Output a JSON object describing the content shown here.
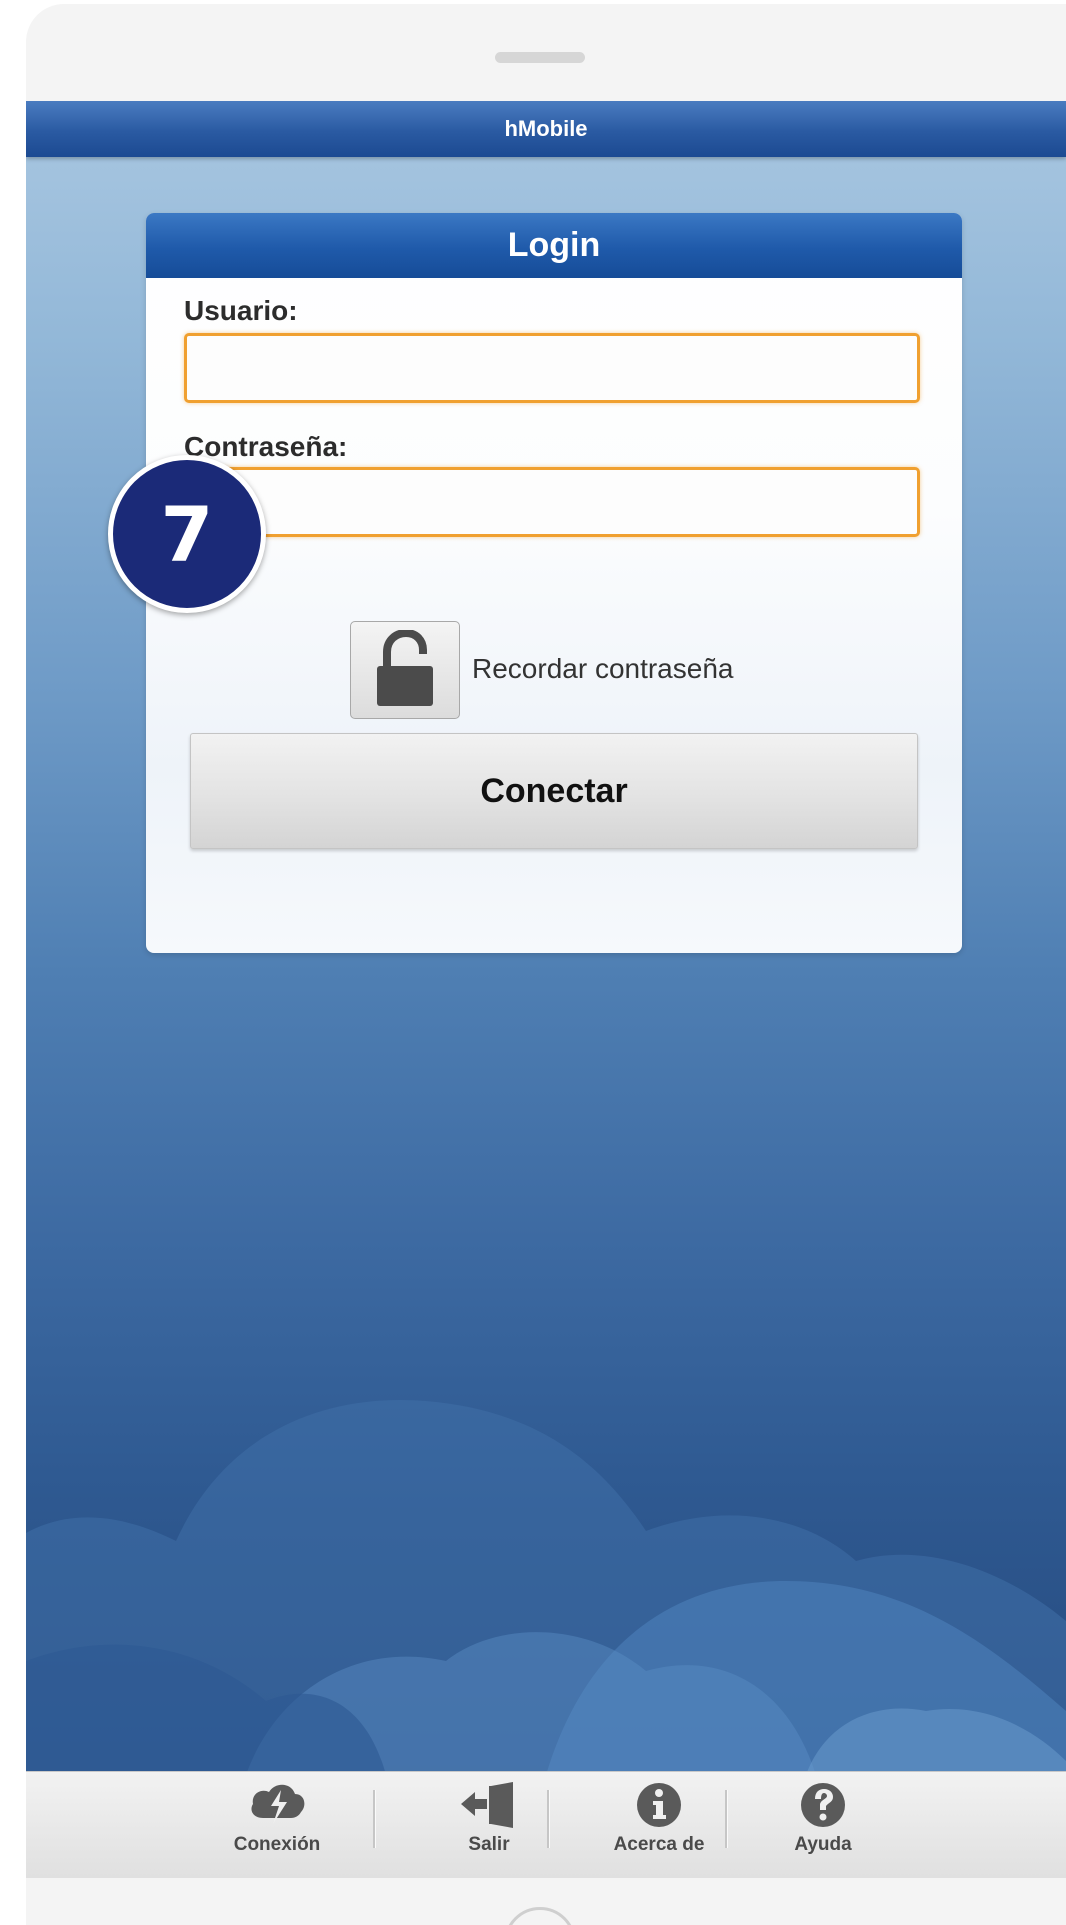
{
  "app": {
    "title": "hMobile"
  },
  "login": {
    "title": "Login",
    "username_label": "Usuario:",
    "username_value": "",
    "password_label": "Contraseña:",
    "password_value": "",
    "remember_label": "Recordar contraseña",
    "connect_label": "Conectar"
  },
  "toolbar": {
    "items": [
      {
        "label": "Conexión",
        "icon": "connection-icon"
      },
      {
        "label": "Salir",
        "icon": "exit-icon"
      },
      {
        "label": "Acerca de",
        "icon": "info-icon"
      },
      {
        "label": "Ayuda",
        "icon": "help-icon"
      }
    ]
  },
  "badge": {
    "number": "7"
  },
  "colors": {
    "header_blue": "#1f5aaa",
    "field_border": "#f0a030",
    "badge": "#1b2a78"
  }
}
